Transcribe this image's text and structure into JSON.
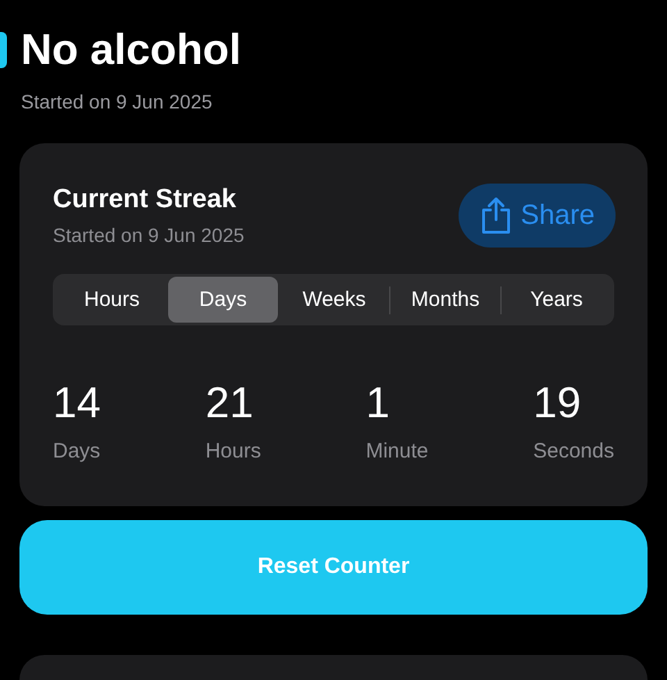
{
  "habit": {
    "title": "No alcohol",
    "started": "Started on 9 Jun 2025"
  },
  "streak_card": {
    "title": "Current Streak",
    "started": "Started on 9 Jun 2025",
    "share_button": "Share",
    "tabs": [
      {
        "label": "Hours",
        "selected": false
      },
      {
        "label": "Days",
        "selected": true
      },
      {
        "label": "Weeks",
        "selected": false
      },
      {
        "label": "Months",
        "selected": false
      },
      {
        "label": "Years",
        "selected": false
      }
    ],
    "counters": [
      {
        "value": "14",
        "unit": "Days"
      },
      {
        "value": "21",
        "unit": "Hours"
      },
      {
        "value": "1",
        "unit": "Minute"
      },
      {
        "value": "19",
        "unit": "Seconds"
      }
    ]
  },
  "reset_button": "Reset Counter"
}
